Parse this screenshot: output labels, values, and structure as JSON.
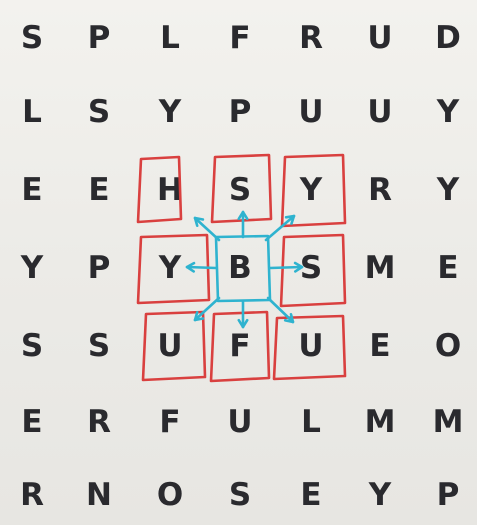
{
  "grid": {
    "rows": [
      [
        "S",
        "P",
        "L",
        "F",
        "R",
        "U",
        "D"
      ],
      [
        "L",
        "S",
        "Y",
        "P",
        "U",
        "U",
        "Y"
      ],
      [
        "E",
        "E",
        "H",
        "S",
        "Y",
        "R",
        "Y"
      ],
      [
        "Y",
        "P",
        "Y",
        "B",
        "S",
        "M",
        "E"
      ],
      [
        "S",
        "S",
        "U",
        "F",
        "U",
        "E",
        "O"
      ],
      [
        "E",
        "R",
        "F",
        "U",
        "L",
        "M",
        "M"
      ],
      [
        "R",
        "N",
        "O",
        "S",
        "E",
        "Y",
        "P"
      ]
    ]
  },
  "annotations": {
    "center_letter": "B",
    "red_box_color": "#d9403f",
    "blue_mark_color": "#2fb3cf"
  }
}
